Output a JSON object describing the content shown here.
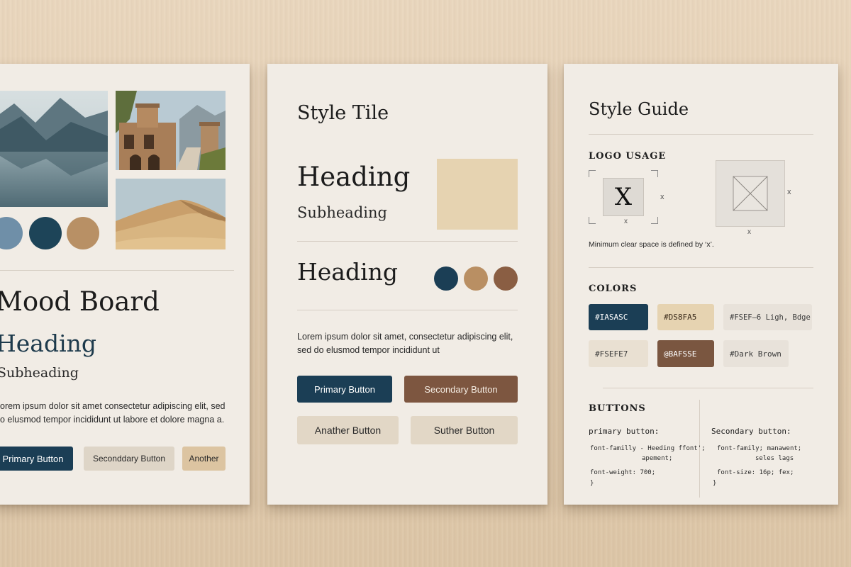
{
  "mood_board": {
    "title": "Mood Board",
    "heading": "Heading",
    "subheading": "Subheading",
    "body_line1": "orem ipsum dolor sit amet consectetur adipiscing elit, sed",
    "body_line2": "o elusmod tempor incididunt ut labore et dolore magna a.",
    "buttons": {
      "primary": "Primary Button",
      "secondary": "Seconddary Button",
      "another": "Another"
    },
    "images": [
      "lake-mountains",
      "villa-building",
      "desert-dunes"
    ],
    "swatches": [
      "#6f8fa8",
      "#1d4458",
      "#b89065"
    ]
  },
  "style_tile": {
    "title": "Style Tile",
    "heading_large": "Heading",
    "subheading": "Subheading",
    "heading_second": "Heading",
    "body_line1": "Lorem ipsum dolor sit amet, consectetur adipiscing elit,",
    "body_line2": "sed do elusmod tempor incididunt ut",
    "buttons": {
      "primary": "Primary Button",
      "secondary": "Secondary Button",
      "another": "Anather Button",
      "other": "Suther Button"
    },
    "swatch_square": "#e6d3b1",
    "swatches": [
      "#1b3e55",
      "#b98f63",
      "#8a5e43"
    ]
  },
  "style_guide": {
    "title": "Style Guide",
    "logo_usage": {
      "title": "LOGO USAGE",
      "logo_letter": "X",
      "x_marker": "x",
      "note": "Minimum clear space is defined by ‘x’."
    },
    "colors": {
      "title": "COLORS",
      "chips": [
        {
          "label": "#IASASC",
          "bg": "#1b3e55",
          "fg": "#ffffff"
        },
        {
          "label": "#DS8FA5",
          "bg": "#e6d3b1",
          "fg": "#3a2a1a"
        },
        {
          "label": "#FSEF–6 Ligh, Bdge",
          "bg": "#ebe5dd",
          "fg": "#3a3a3a"
        },
        {
          "label": "#FSEFE7",
          "bg": "#e9e0d2",
          "fg": "#3a3a3a"
        },
        {
          "label": "@BAFSSE",
          "bg": "#7a5640",
          "fg": "#ffffff"
        },
        {
          "label": "#Dark Brown",
          "bg": "#ebe5dd",
          "fg": "#3a3a3a"
        }
      ]
    },
    "buttons_section": {
      "title": "BUTTONS",
      "primary_label": "primary button:",
      "primary_lines": [
        "font-familly - Heeding ffont';",
        "apement;",
        "font-weight: 700;",
        "}"
      ],
      "secondary_label": "Secondary button:",
      "secondary_lines": [
        "font-family; manawent;",
        "seles lags",
        "font-size: 16p;  fex;",
        "}"
      ]
    }
  }
}
